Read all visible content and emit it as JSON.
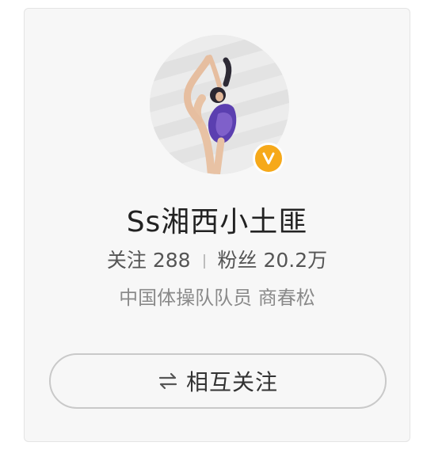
{
  "profile": {
    "username": "Ss湘西小土匪",
    "following_label": "关注",
    "following_count": "288",
    "followers_label": "粉丝",
    "followers_count": "20.2万",
    "bio": "中国体操队队员 商春松",
    "verified_icon": "verified-v-badge-icon",
    "verified_color": "#f6a91a"
  },
  "action": {
    "follow_label": "相互关注",
    "follow_icon": "mutual-follow-arrows-icon"
  }
}
